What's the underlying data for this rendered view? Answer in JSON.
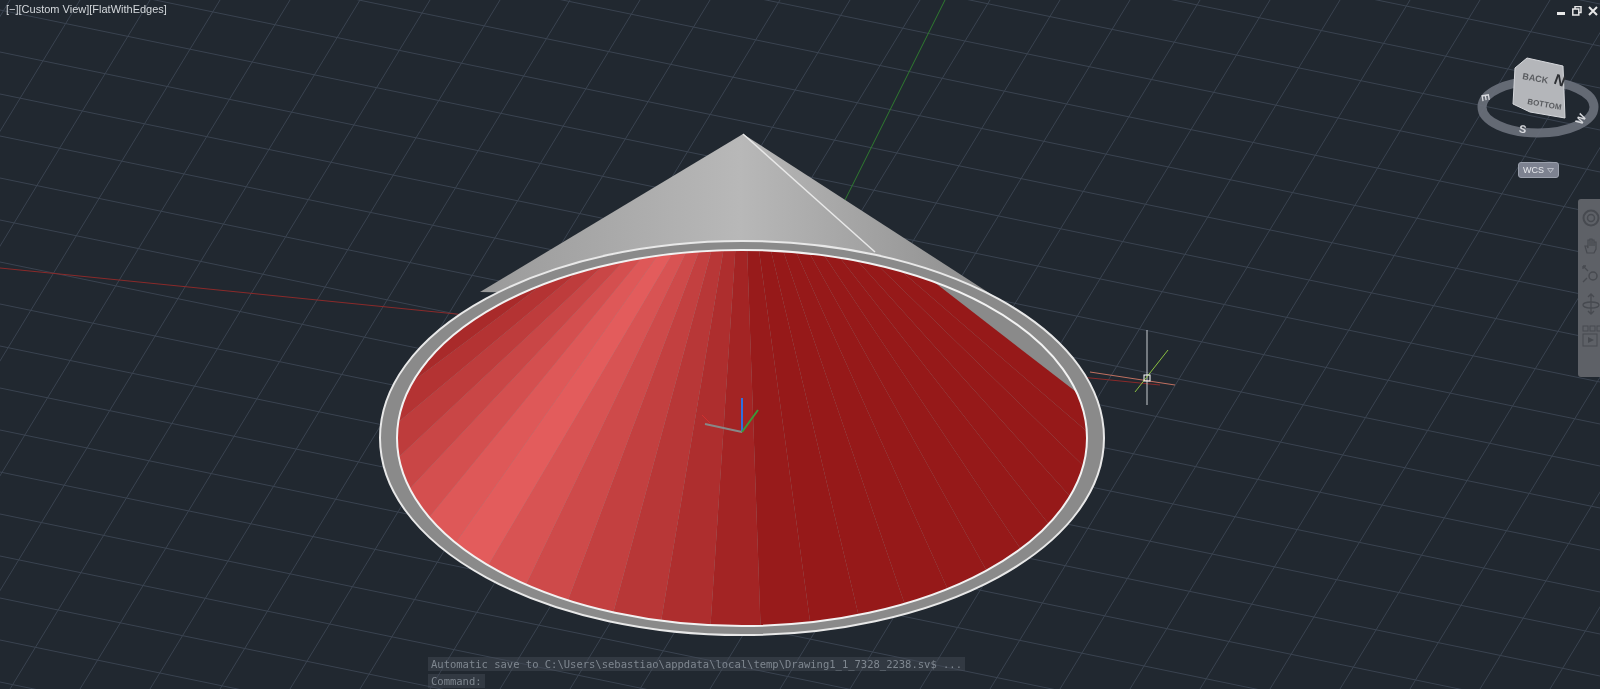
{
  "viewport": {
    "label": "[−][Custom View][FlatWithEdges]"
  },
  "viewcube": {
    "faces": [
      {
        "kind": "top",
        "label": "BACK"
      },
      {
        "kind": "front",
        "label": "BOTTOM"
      }
    ],
    "compass": [
      {
        "kind": "n",
        "letter": "N"
      },
      {
        "kind": "e",
        "letter": "E"
      },
      {
        "kind": "s",
        "letter": "S"
      },
      {
        "kind": "w",
        "letter": "W"
      }
    ],
    "ucs_button": {
      "label": "WCS"
    }
  },
  "command_line": {
    "history": [
      "Automatic save to C:\\Users\\sebastiao\\appdata\\local\\temp\\Drawing1_1_7328_2238.sv$ ..."
    ],
    "prompt": "Command:"
  }
}
